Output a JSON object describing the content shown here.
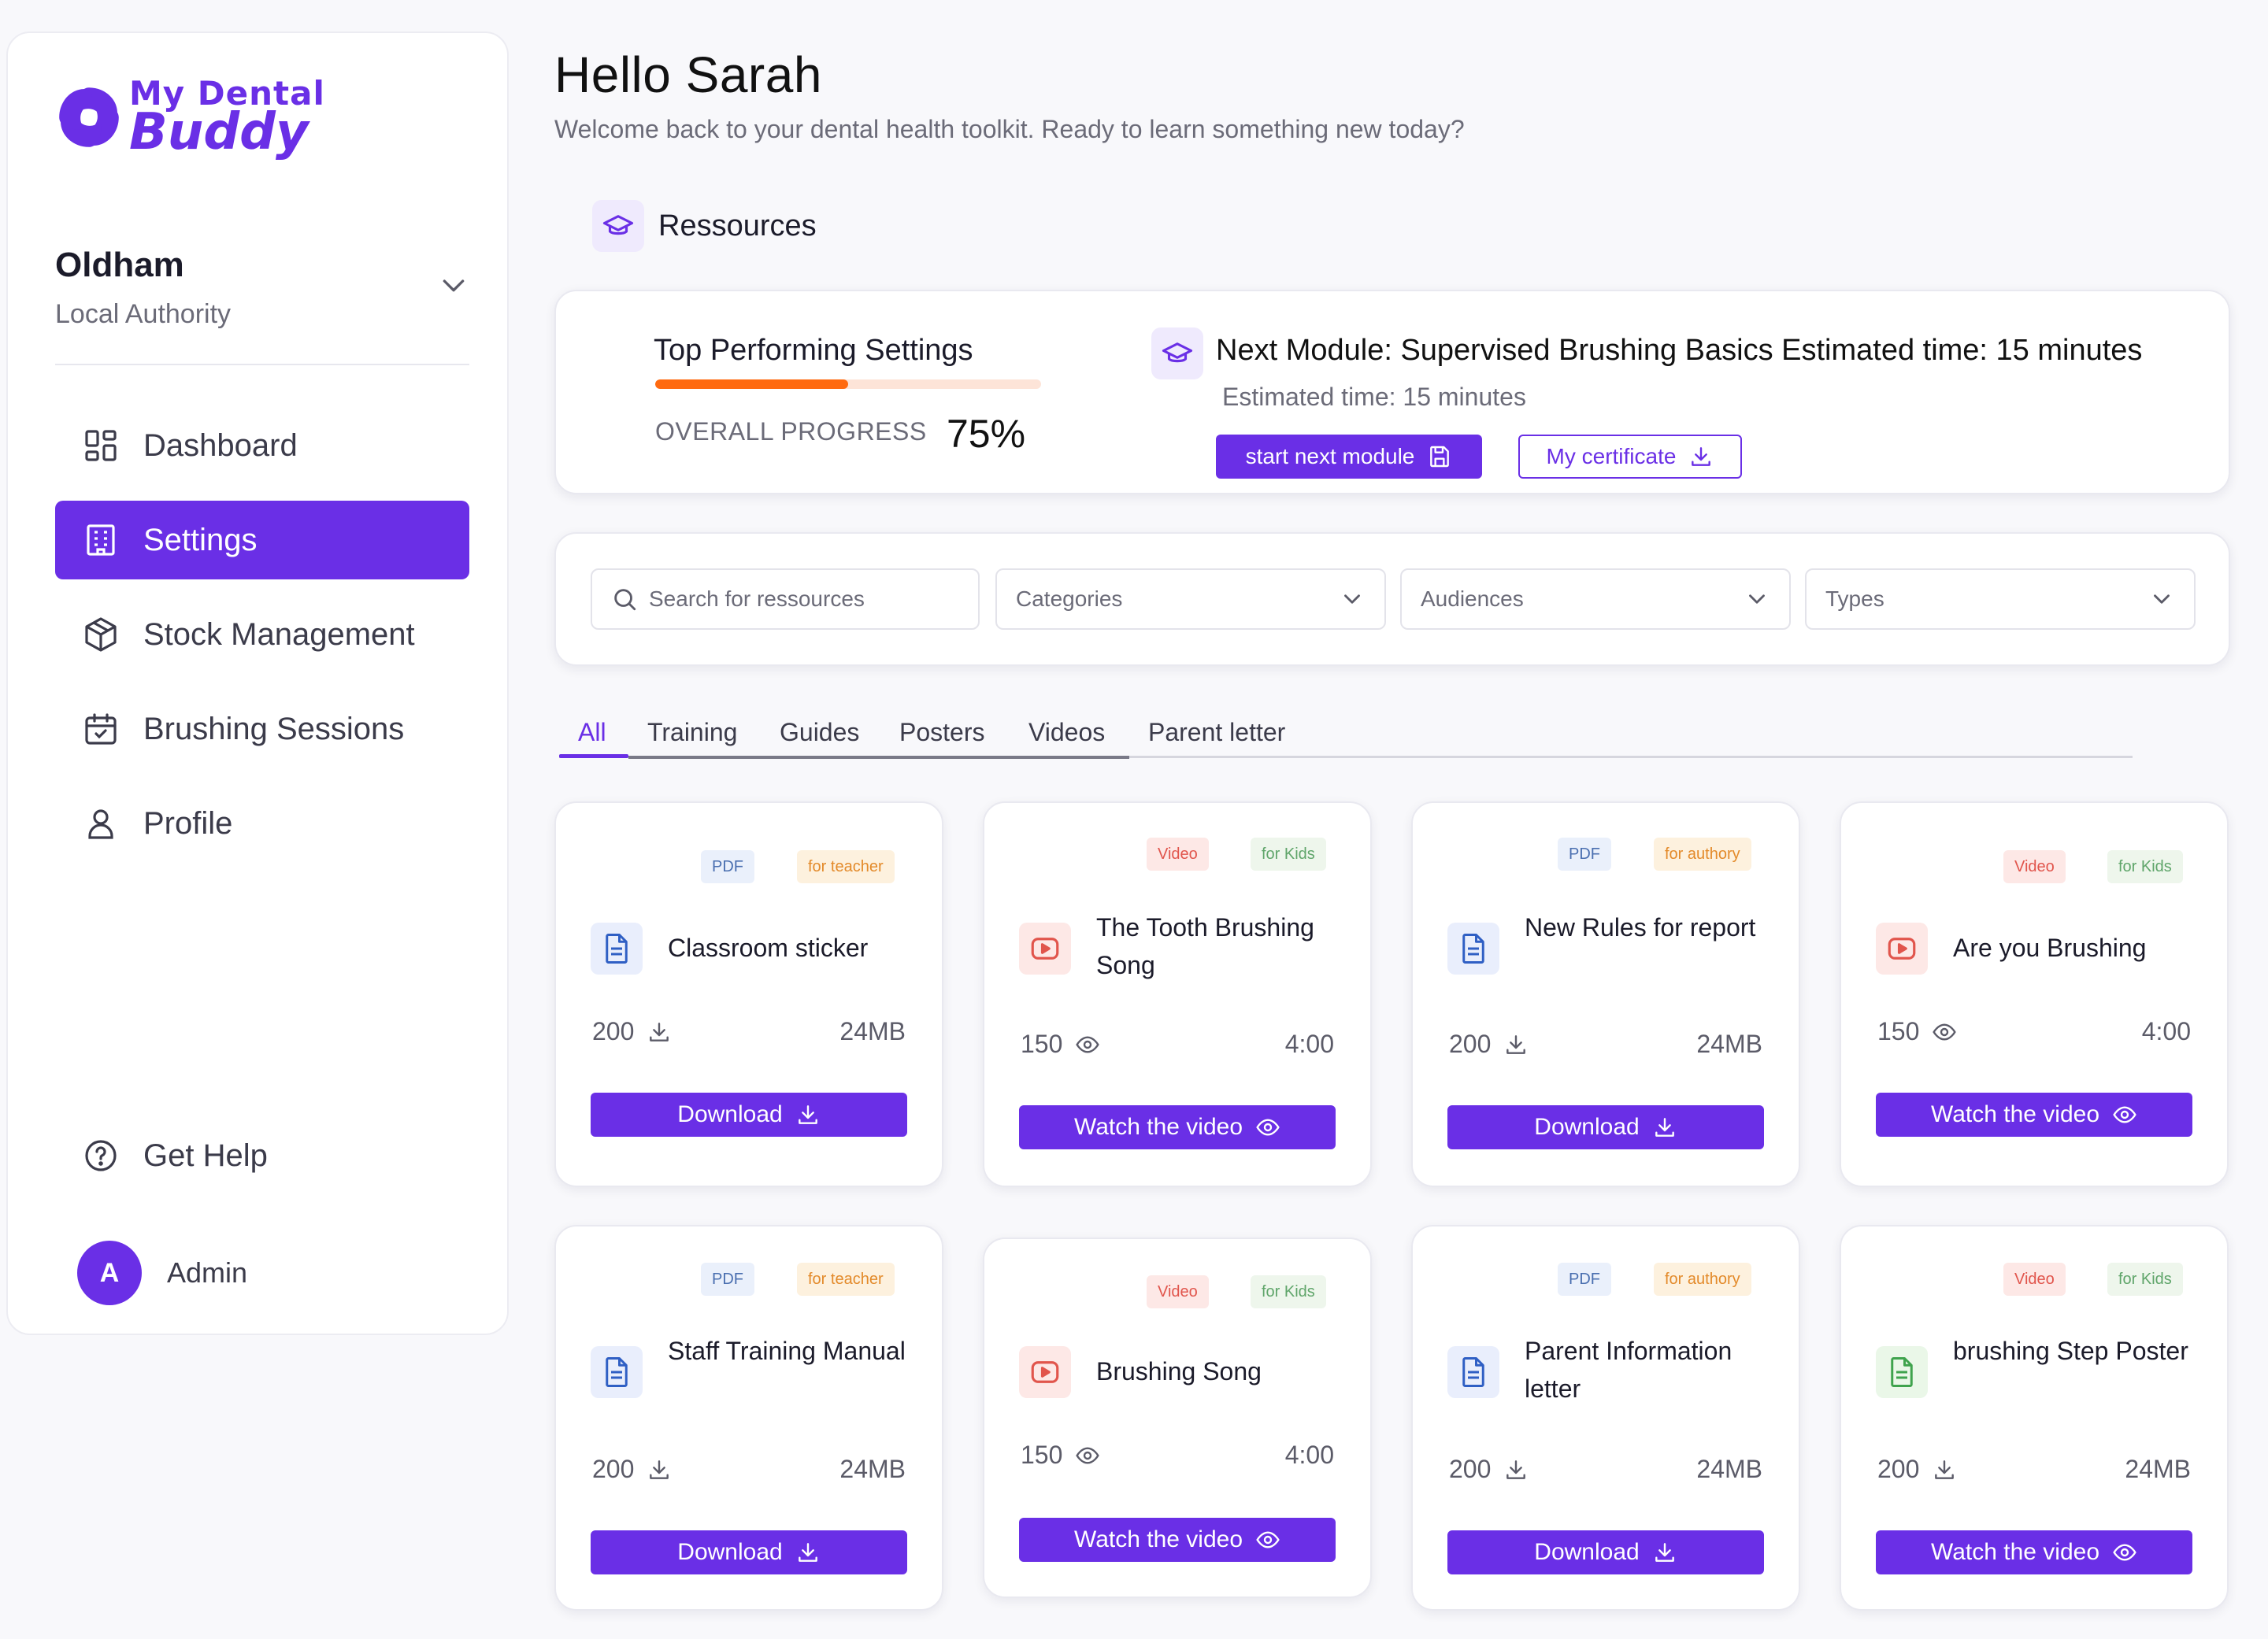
{
  "brand": {
    "line1": "My Dental",
    "line2": "Buddy",
    "color": "#6a2fe6"
  },
  "org": {
    "name": "Oldham",
    "type": "Local Authority"
  },
  "nav": [
    {
      "label": "Dashboard",
      "icon": "dashboard-icon"
    },
    {
      "label": "Settings",
      "icon": "building-icon",
      "active": true
    },
    {
      "label": "Stock Management",
      "icon": "box-icon"
    },
    {
      "label": "Brushing Sessions",
      "icon": "calendar-icon"
    },
    {
      "label": "Profile",
      "icon": "user-icon"
    }
  ],
  "help": {
    "label": "Get Help"
  },
  "user": {
    "initial": "A",
    "name": "Admin"
  },
  "greeting": {
    "title": "Hello Sarah",
    "subtitle": "Welcome back to your dental health toolkit. Ready to learn something new today?"
  },
  "section": {
    "title": "Ressources"
  },
  "progress": {
    "title": "Top Performing Settings",
    "label": "OVERALL PROGRESS",
    "value": "75%",
    "fraction": 0.5
  },
  "next_module": {
    "title": "Next Module: Supervised Brushing Basics Estimated time: 15 minutes",
    "estimate": "Estimated time: 15 minutes",
    "start_label": "start next module",
    "certificate_label": "My certificate"
  },
  "filters": {
    "search_placeholder": "Search for ressources",
    "categories": "Categories",
    "audiences": "Audiences",
    "types": "Types"
  },
  "tabs": [
    "All",
    "Training",
    "Guides",
    "Posters",
    "Videos",
    "Parent letter"
  ],
  "resources": [
    {
      "title": "Classroom sticker",
      "format": "PDF",
      "audience": "for teacher",
      "count": "200",
      "count_icon": "download-icon",
      "meta": "24MB",
      "action": "Download",
      "action_icon": "download-icon"
    },
    {
      "title": "The Tooth Brushing Song",
      "format": "Video",
      "audience": "for Kids",
      "count": "150",
      "count_icon": "eye-icon",
      "meta": "4:00",
      "action": "Watch the video",
      "action_icon": "eye-icon"
    },
    {
      "title": "New Rules for report",
      "format": "PDF",
      "audience": "for authory",
      "count": "200",
      "count_icon": "download-icon",
      "meta": "24MB",
      "action": "Download",
      "action_icon": "download-icon"
    },
    {
      "title": "Are you Brushing",
      "format": "Video",
      "audience": "for Kids",
      "count": "150",
      "count_icon": "eye-icon",
      "meta": "4:00",
      "action": "Watch the video",
      "action_icon": "eye-icon"
    },
    {
      "title": "Staff Training Manual",
      "format": "PDF",
      "audience": "for teacher",
      "count": "200",
      "count_icon": "download-icon",
      "meta": "24MB",
      "action": "Download",
      "action_icon": "download-icon"
    },
    {
      "title": "Brushing Song",
      "format": "Video",
      "audience": "for Kids",
      "count": "150",
      "count_icon": "eye-icon",
      "meta": "4:00",
      "action": "Watch the video",
      "action_icon": "eye-icon"
    },
    {
      "title": "Parent Information letter",
      "format": "PDF",
      "audience": "for authory",
      "count": "200",
      "count_icon": "download-icon",
      "meta": "24MB",
      "action": "Download",
      "action_icon": "download-icon"
    },
    {
      "title": "brushing Step Poster",
      "format": "Video",
      "audience": "for Kids",
      "count": "200",
      "count_icon": "download-icon",
      "meta": "24MB",
      "action": "Watch the video",
      "action_icon": "eye-icon"
    }
  ]
}
